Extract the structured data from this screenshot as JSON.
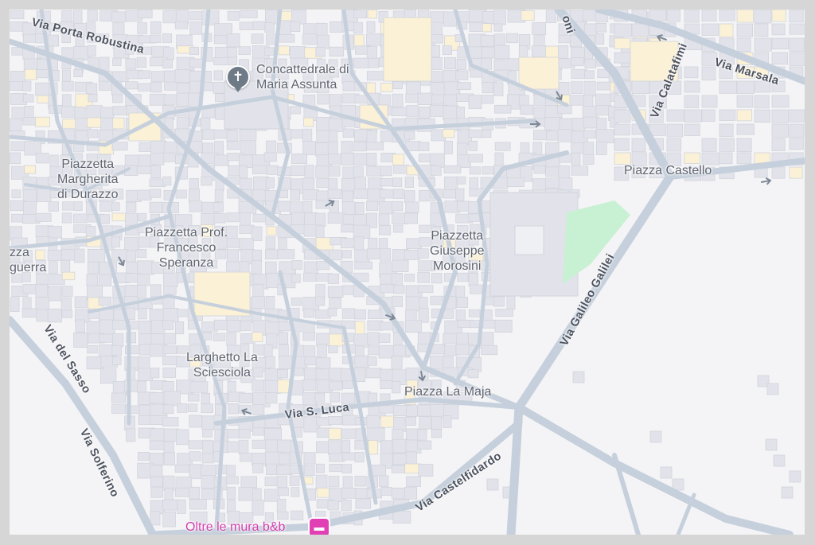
{
  "map": {
    "colors": {
      "background": "#f4f4f6",
      "block": "#e2e3ea",
      "block_edge": "#d2d4dc",
      "road": "#c6d0dc",
      "road_edge": "#b6c1cf",
      "highlight_block": "#fbf1d6",
      "park": "#c8f0d2",
      "arrow": "#7b8796",
      "frame": "#d6d6d6"
    },
    "places": [
      {
        "id": "concattedrale",
        "name": "Concattedrale di\nMaria Assunta",
        "icon": "cross-church-icon"
      },
      {
        "id": "margherita",
        "name": "Piazzetta\nMargherita\ndi Durazzo"
      },
      {
        "id": "speranza",
        "name": "Piazzetta Prof.\nFrancesco\nSperanza"
      },
      {
        "id": "morosini",
        "name": "Piazzetta\nGiuseppe\nMorosini"
      },
      {
        "id": "castello",
        "name": "Piazza Castello"
      },
      {
        "id": "sciesciola",
        "name": "Larghetto La\nSciesciola"
      },
      {
        "id": "maja",
        "name": "Piazza La Maja"
      },
      {
        "id": "piazza-cut",
        "name": "zza\nguerra"
      }
    ],
    "streets": [
      {
        "id": "porta-robustina",
        "name": "Via Porta Robustina"
      },
      {
        "id": "calatafimi",
        "name": "Via Calatafimi"
      },
      {
        "id": "marsala",
        "name": "Via Marsala"
      },
      {
        "id": "galilei",
        "name": "Via Galileo Galilei"
      },
      {
        "id": "sasso",
        "name": "Via del Sasso"
      },
      {
        "id": "solferino",
        "name": "Via Solferino"
      },
      {
        "id": "sluca",
        "name": "Via S. Luca"
      },
      {
        "id": "castelfidardo",
        "name": "Via Castelfidardo"
      },
      {
        "id": "oni",
        "name": "oni"
      }
    ],
    "hotel": {
      "name": "Oltre le mura b&b",
      "icon": "bed-icon",
      "color": "#e33fb5"
    }
  }
}
